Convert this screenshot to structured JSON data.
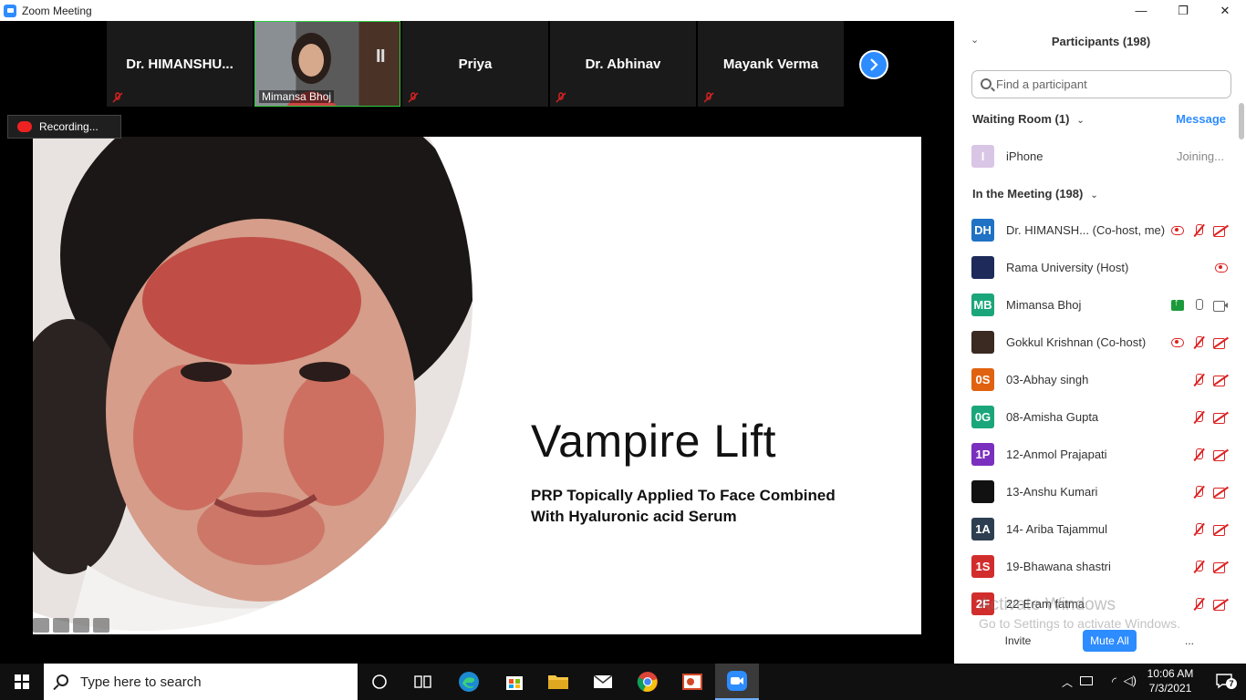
{
  "window": {
    "title": "Zoom Meeting",
    "controls": {
      "minimize": "—",
      "restore": "❐",
      "close": "✕"
    }
  },
  "filmstrip": {
    "tiles": [
      {
        "name": "Dr.  HIMANSHU...",
        "muted": true
      },
      {
        "name": "Mimansa Bhoj",
        "video": true
      },
      {
        "name": "Priya",
        "muted": true
      },
      {
        "name": "Dr. Abhinav",
        "muted": true
      },
      {
        "name": "Mayank Verma",
        "muted": true
      }
    ],
    "next_icon": "chevron-right-icon"
  },
  "recording": {
    "label": "Recording..."
  },
  "slide": {
    "title": "Vampire Lift",
    "subtitle": "PRP Topically Applied To Face Combined With Hyaluronic acid Serum"
  },
  "panel": {
    "title": "Participants (198)",
    "search_placeholder": "Find a participant",
    "waiting_room": {
      "header": "Waiting Room (1)",
      "message_label": "Message",
      "participants": [
        {
          "initials": "I",
          "name": "iPhone",
          "status": "Joining...",
          "color": "#d9c6e6"
        }
      ]
    },
    "in_meeting": {
      "header": "In the Meeting (198)",
      "participants": [
        {
          "initials": "DH",
          "name": "Dr. HIMANSH... (Co-host, me)",
          "color": "#1f72c4",
          "icons": [
            "rec",
            "mic-off",
            "vid-off"
          ]
        },
        {
          "initials": "",
          "name": "Rama University (Host)",
          "color": "#1d2a5a",
          "icons": [
            "rec"
          ]
        },
        {
          "initials": "MB",
          "name": "Mimansa Bhoj",
          "color": "#1aa67a",
          "icons": [
            "share",
            "mic",
            "vid"
          ]
        },
        {
          "initials": "",
          "name": "Gokkul Krishnan (Co-host)",
          "color": "#3b2a22",
          "icons": [
            "rec",
            "mic-off",
            "vid-off"
          ]
        },
        {
          "initials": "0S",
          "name": "03-Abhay singh",
          "color": "#e06210",
          "icons": [
            "mic-off",
            "vid-off"
          ]
        },
        {
          "initials": "0G",
          "name": "08-Amisha Gupta",
          "color": "#1aa67a",
          "icons": [
            "mic-off",
            "vid-off"
          ]
        },
        {
          "initials": "1P",
          "name": "12-Anmol Prajapati",
          "color": "#7b2fbf",
          "icons": [
            "mic-off",
            "vid-off"
          ]
        },
        {
          "initials": "",
          "name": "13-Anshu Kumari",
          "color": "#111111",
          "icons": [
            "mic-off",
            "vid-off"
          ]
        },
        {
          "initials": "1A",
          "name": "14- Ariba Tajammul",
          "color": "#2d3e50",
          "icons": [
            "mic-off",
            "vid-off"
          ]
        },
        {
          "initials": "1S",
          "name": "19-Bhawana shastri",
          "color": "#d22d2d",
          "icons": [
            "mic-off",
            "vid-off"
          ]
        },
        {
          "initials": "2F",
          "name": "22-Eram fatma",
          "color": "#d22d2d",
          "icons": [
            "mic-off",
            "vid-off"
          ]
        }
      ]
    },
    "watermark": {
      "line1": "Activate Windows",
      "line2": "Go to Settings to activate Windows."
    },
    "buttons": {
      "invite": "Invite",
      "mute_all": "Mute All",
      "more": "..."
    }
  },
  "taskbar": {
    "search_placeholder": "Type here to search",
    "apps": [
      "cortana-icon",
      "task-view-icon",
      "edge-icon",
      "store-icon",
      "file-explorer-icon",
      "mail-icon",
      "chrome-icon",
      "powerpoint-icon",
      "zoom-icon"
    ],
    "clock": {
      "time": "10:06 AM",
      "date": "7/3/2021"
    },
    "notification_count": "7"
  }
}
